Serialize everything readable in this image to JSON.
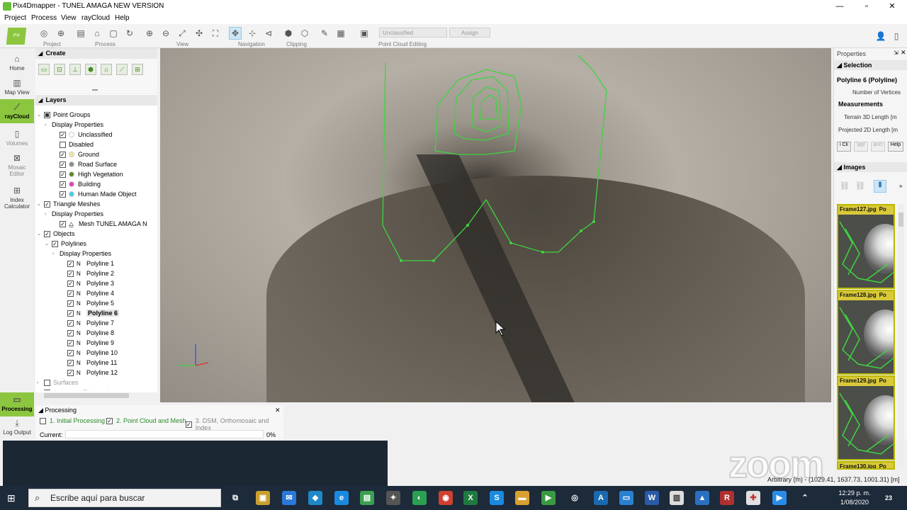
{
  "window": {
    "title": "Pix4Dmapper - TUNEL AMAGA NEW VERSION"
  },
  "menu": [
    "Project",
    "Process",
    "View",
    "rayCloud",
    "Help"
  ],
  "toolbar": {
    "groups": [
      "Project",
      "Process",
      "View",
      "Navigation",
      "Clipping",
      "Point Cloud Editing"
    ],
    "class_dropdown": "Unclassified",
    "assign_label": "Assign"
  },
  "leftnav": [
    {
      "label": "Home",
      "icon": "home-icon"
    },
    {
      "label": "Map View",
      "icon": "map-icon"
    },
    {
      "label": "rayCloud",
      "icon": "raycloud-icon"
    },
    {
      "label": "Volumes",
      "icon": "volumes-icon"
    },
    {
      "label": "Mosaic Editor",
      "icon": "mosaic-icon"
    },
    {
      "label": "Index Calculator",
      "icon": "index-icon"
    },
    {
      "label": "Processing",
      "icon": "processing-icon"
    },
    {
      "label": "Log Output",
      "icon": "log-icon"
    }
  ],
  "create_panel": {
    "title": "Create"
  },
  "layers_panel": {
    "title": "Layers",
    "rows": [
      {
        "label": "Point Groups",
        "level": 0,
        "expand": "v",
        "cb": "solid"
      },
      {
        "label": "Display Properties",
        "level": 1,
        "expand": ">",
        "cb": "none"
      },
      {
        "label": "Unclassified",
        "level": 2,
        "cb": "checked",
        "color": "#ffffff"
      },
      {
        "label": "Disabled",
        "level": 2,
        "cb": "unchecked",
        "color": ""
      },
      {
        "label": "Ground",
        "level": 2,
        "cb": "checked",
        "color": "#e8e8a0"
      },
      {
        "label": "Road Surface",
        "level": 2,
        "cb": "checked",
        "color": "#8c8c8c"
      },
      {
        "label": "High Vegetation",
        "level": 2,
        "cb": "checked",
        "color": "#5a8a2a"
      },
      {
        "label": "Building",
        "level": 2,
        "cb": "checked",
        "color": "#e040c0"
      },
      {
        "label": "Human Made Object",
        "level": 2,
        "cb": "checked",
        "color": "#40d0e0"
      },
      {
        "label": "Triangle Meshes",
        "level": 0,
        "expand": "v",
        "cb": "checked"
      },
      {
        "label": "Display Properties",
        "level": 1,
        "expand": ">",
        "cb": "none"
      },
      {
        "label": "Mesh TUNEL AMAGA N",
        "level": 2,
        "cb": "checked",
        "color": "mesh"
      },
      {
        "label": "Objects",
        "level": 0,
        "expand": "v",
        "cb": "checked"
      },
      {
        "label": "Polylines",
        "level": 1,
        "expand": "v",
        "cb": "checked"
      },
      {
        "label": "Display Properties",
        "level": 2,
        "expand": ">",
        "cb": "none"
      },
      {
        "label": "Polyline 1",
        "level": 3,
        "cb": "checked",
        "color": "poly"
      },
      {
        "label": "Polyline 2",
        "level": 3,
        "cb": "checked",
        "color": "poly"
      },
      {
        "label": "Polyline 3",
        "level": 3,
        "cb": "checked",
        "color": "poly"
      },
      {
        "label": "Polyline 4",
        "level": 3,
        "cb": "checked",
        "color": "poly"
      },
      {
        "label": "Polyline 5",
        "level": 3,
        "cb": "checked",
        "color": "poly"
      },
      {
        "label": "Polyline 6",
        "level": 3,
        "cb": "checked",
        "color": "poly",
        "selected": true
      },
      {
        "label": "Polyline 7",
        "level": 3,
        "cb": "checked",
        "color": "poly"
      },
      {
        "label": "Polyline 8",
        "level": 3,
        "cb": "checked",
        "color": "poly"
      },
      {
        "label": "Polyline 9",
        "level": 3,
        "cb": "checked",
        "color": "poly"
      },
      {
        "label": "Polyline 10",
        "level": 3,
        "cb": "checked",
        "color": "poly"
      },
      {
        "label": "Polyline 11",
        "level": 3,
        "cb": "checked",
        "color": "poly"
      },
      {
        "label": "Polyline 12",
        "level": 3,
        "cb": "checked",
        "color": "poly"
      },
      {
        "label": "Surfaces",
        "level": 0,
        "expand": ">",
        "cb": "unchecked",
        "dim": true
      },
      {
        "label": "Animation Trajectories",
        "level": 0,
        "expand": ">",
        "cb": "unchecked",
        "dim": true
      }
    ]
  },
  "properties_panel": {
    "title": "Properties",
    "selection_title": "Selection",
    "selected_item": "Polyline 6 (Polyline)",
    "vertices_label": "Number of Vertices",
    "measurements_title": "Measurements",
    "terrain_label": "Terrain 3D Length [m",
    "projected_label": "Projected 2D Length [m",
    "buttons": [
      "i Cli",
      "\\ppl",
      "ancr",
      "Help"
    ],
    "images_title": "Images",
    "frames": [
      {
        "name": "Frame127.jpg",
        "suffix": "Po"
      },
      {
        "name": "Frame128.jpg",
        "suffix": "Po"
      },
      {
        "name": "Frame129.jpg",
        "suffix": "Po"
      },
      {
        "name": "Frame130.jpg",
        "suffix": "Po"
      }
    ]
  },
  "processing_panel": {
    "title": "Processing",
    "steps": [
      {
        "label": "1. Initial Processing",
        "checked": false
      },
      {
        "label": "2. Point Cloud and Mesh",
        "checked": true
      },
      {
        "label": "3. DSM, Orthomosaic and Index",
        "checked": true
      }
    ],
    "current_label": "Current:",
    "percent": "0%"
  },
  "statusbar": {
    "coords": "Arbitrary (m) - (1029.41, 1637.73, 1001.31) [m]"
  },
  "overlay": {
    "watermark": "zoom"
  },
  "taskbar": {
    "search_placeholder": "Escribe aquí para buscar",
    "time": "12:29 p. m.",
    "date": "1/08/2020",
    "notif_count": "23"
  },
  "colors": {
    "accent": "#8cc63f",
    "polyline": "#3fd43f"
  }
}
